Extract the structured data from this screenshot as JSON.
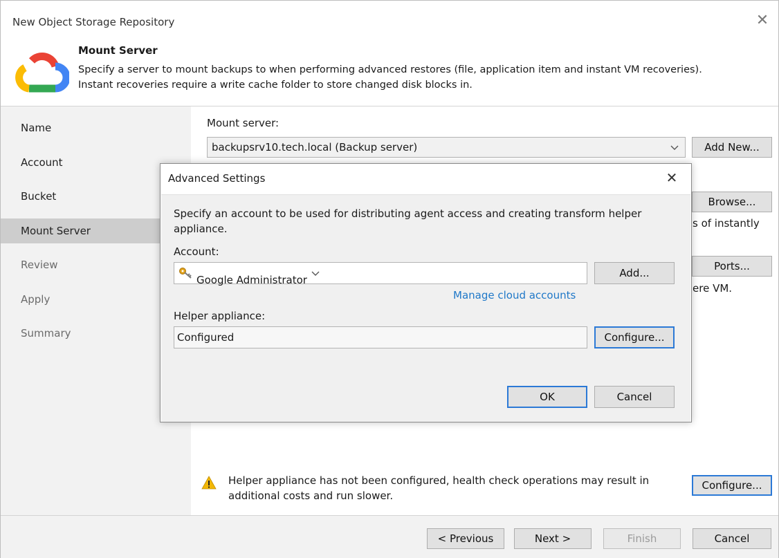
{
  "window": {
    "title": "New Object Storage Repository",
    "close_glyph": "✕"
  },
  "header": {
    "title": "Mount Server",
    "description_line1": "Specify a server to mount backups to when performing advanced restores (file, application item and instant VM recoveries).",
    "description_line2": "Instant recoveries require a write cache folder to store changed disk blocks in.",
    "logo_icon": "google-cloud-logo-icon"
  },
  "sidebar": {
    "items": [
      {
        "label": "Name",
        "state": "done"
      },
      {
        "label": "Account",
        "state": "done"
      },
      {
        "label": "Bucket",
        "state": "done"
      },
      {
        "label": "Mount Server",
        "state": "active"
      },
      {
        "label": "Review",
        "state": "pending"
      },
      {
        "label": "Apply",
        "state": "pending"
      },
      {
        "label": "Summary",
        "state": "pending"
      }
    ]
  },
  "main": {
    "mount_server_label": "Mount server:",
    "mount_server_value": "backupsrv10.tech.local (Backup server)",
    "add_new_label": "Add New...",
    "browse_label": "Browse...",
    "ports_label": "Ports...",
    "partial_text_1": "s of instantly",
    "partial_text_2": "ere VM.",
    "warning_text_line1": "Helper appliance has not been configured, health check operations may result in",
    "warning_text_line2": "additional costs and run slower.",
    "configure_label": "Configure..."
  },
  "dialog": {
    "title": "Advanced Settings",
    "close_glyph": "✕",
    "description_line1": "Specify an account to be used for distributing agent access and creating transform helper",
    "description_line2": "appliance.",
    "account_label": "Account:",
    "account_value": "Google Administrator",
    "add_label": "Add...",
    "manage_link": "Manage cloud accounts",
    "helper_label": "Helper appliance:",
    "helper_value": "Configured",
    "configure_label": "Configure...",
    "ok_label": "OK",
    "cancel_label": "Cancel"
  },
  "footer": {
    "previous_label": "< Previous",
    "next_label": "Next >",
    "finish_label": "Finish",
    "cancel_label": "Cancel"
  },
  "colors": {
    "accent": "#2b79d6",
    "link": "#1f78c8",
    "sidebar_bg": "#f2f2f2",
    "sidebar_active": "#cdcdcd",
    "warning": "#f2b705"
  }
}
